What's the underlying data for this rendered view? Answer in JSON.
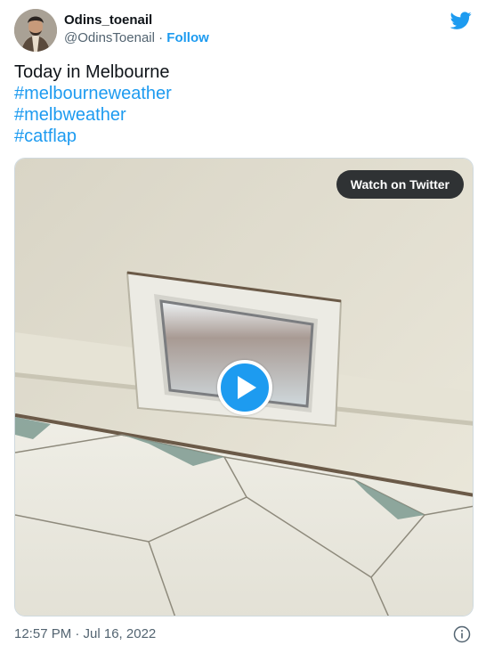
{
  "user": {
    "display_name": "Odins_toenail",
    "handle": "@OdinsToenail",
    "separator": "·",
    "follow_label": "Follow"
  },
  "tweet": {
    "text": "Today in Melbourne",
    "hashtags": [
      "#melbourneweather",
      "#melbweather",
      "#catflap"
    ]
  },
  "media": {
    "watch_label": "Watch on Twitter",
    "play_icon": "play-icon"
  },
  "footer": {
    "timestamp": "12:57 PM · Jul 16, 2022",
    "info_icon": "info-icon"
  },
  "colors": {
    "accent": "#1d9bf0",
    "text": "#0f1419",
    "secondary": "#536471"
  }
}
